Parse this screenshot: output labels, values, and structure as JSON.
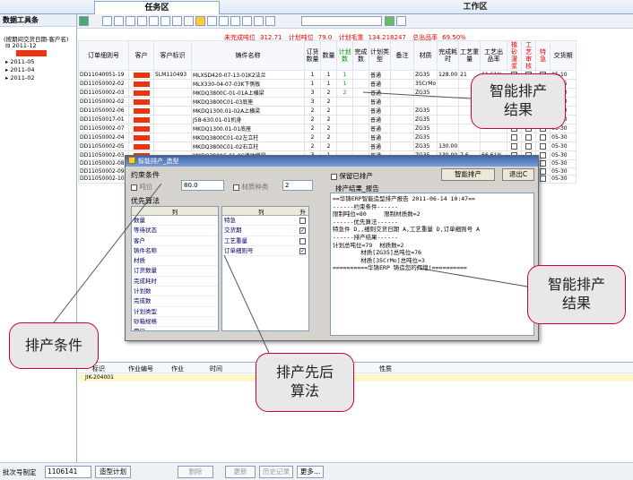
{
  "tabs": [
    "任务区",
    "工作区"
  ],
  "left_panel": {
    "title": "数据工具条",
    "root": "(按期间交货日期-客户名)",
    "nodes": [
      "2011-12",
      "2011-05",
      "2011-04",
      "2011-02"
    ]
  },
  "stats": {
    "uncompleted_label": "未完成吨位",
    "uncompleted_value": "312.71",
    "plan_label": "计划吨位",
    "plan_value": "79.0",
    "plan_weight_label": "计划毛重",
    "plan_weight_value": "134.218247",
    "yield_label": "总出品率",
    "yield_value": "69.50%"
  },
  "grid": {
    "headers": [
      "订单细则号",
      "客户",
      "客户标识",
      "铸件名称",
      "订货数量",
      "数量",
      "计划数",
      "完成数",
      "计划类型",
      "备注",
      "材质",
      "完成耗时",
      "工艺重量",
      "工艺出品率",
      "植砂灌浆",
      "工艺审核",
      "特急",
      "交货期"
    ],
    "rows": [
      {
        "id": "DD11040051-19",
        "tag": "5LM110493",
        "name": "MLXSD420-07-13-01K2法兰",
        "qty": "1",
        "n": "1",
        "plan": "1",
        "done": "",
        "type": "普通",
        "mat": "ZG35",
        "t": "128.00",
        "w": "21",
        "y": "61.61%",
        "due": "05-10"
      },
      {
        "id": "DD11050002-02",
        "tag": "",
        "name": "MLX330-04-07-03K下侧板",
        "qty": "1",
        "n": "1",
        "plan": "1",
        "done": "",
        "type": "普通",
        "mat": "35CrMo",
        "t": "",
        "w": "",
        "y": "",
        "due": "05-15"
      },
      {
        "id": "DD11050002-03",
        "tag": "",
        "name": "MKDQ3800C-01-01A上横梁",
        "qty": "3",
        "n": "2",
        "plan": "2",
        "done": "",
        "type": "普通",
        "mat": "ZG35",
        "t": "",
        "w": "",
        "y": "",
        "due": "05-30"
      },
      {
        "id": "DD11050002-02",
        "tag": "",
        "name": "MKDQ3800C01-03底座",
        "qty": "3",
        "n": "2",
        "plan": "",
        "done": "",
        "type": "普通",
        "mat": "",
        "t": "",
        "w": "",
        "y": "",
        "due": "05-30"
      },
      {
        "id": "DD11050002-06",
        "tag": "",
        "name": "MKDQ1300.01-02A上横梁",
        "qty": "2",
        "n": "2",
        "plan": "",
        "done": "",
        "type": "普通",
        "mat": "ZG35",
        "t": "",
        "w": "",
        "y": "",
        "due": "05-30"
      },
      {
        "id": "DD11050017-01",
        "tag": "",
        "name": "J58-630.01-01机身",
        "qty": "2",
        "n": "2",
        "plan": "",
        "done": "",
        "type": "普通",
        "mat": "ZG35",
        "t": "",
        "w": "",
        "y": "",
        "due": "05-30"
      },
      {
        "id": "DD11050002-07",
        "tag": "",
        "name": "MKDQ1300.01-01底座",
        "qty": "2",
        "n": "2",
        "plan": "",
        "done": "",
        "type": "普通",
        "mat": "ZG35",
        "t": "",
        "w": "",
        "y": "",
        "due": "05-30"
      },
      {
        "id": "DD11050002-04",
        "tag": "",
        "name": "MKDQ3800C01-02左立柱",
        "qty": "2",
        "n": "2",
        "plan": "",
        "done": "",
        "type": "普通",
        "mat": "ZG35",
        "t": "",
        "w": "",
        "y": "",
        "due": "05-30"
      },
      {
        "id": "DD11050002-05",
        "tag": "",
        "name": "MKDQ3800C01-02右立柱",
        "qty": "2",
        "n": "2",
        "plan": "",
        "done": "",
        "type": "普通",
        "mat": "ZG35",
        "t": "130.00",
        "w": "",
        "y": "",
        "due": "05-30"
      },
      {
        "id": "DD11050002-03",
        "tag": "",
        "name": "MKDQ3800C-01-06活动横梁",
        "qty": "3",
        "n": "1",
        "plan": "",
        "done": "",
        "type": "普通",
        "mat": "ZG35",
        "t": "130.00",
        "w": "7.6",
        "y": "66.61%",
        "due": "05-30"
      }
    ],
    "extra_ids": [
      "DD11050002-08",
      "DD11050002-09",
      "DD11050002-10",
      "DD10110072-0"
    ],
    "extra_due": [
      "05-30",
      "05-30",
      "05-30",
      "12-05"
    ]
  },
  "dialog": {
    "title": "智能排产_造型",
    "keep_label": "保留已排产",
    "run_button": "智能排产",
    "exit_button": "退出C",
    "constraints_label": "约束条件",
    "tonnage_label": "吨位",
    "tonnage_value": "80.0",
    "material_label": "材质种类",
    "material_value": "2",
    "priority_label": "优先算法",
    "col_header": "列",
    "left_list": [
      "数量",
      "等待状态",
      "客户",
      "铸件名称",
      "材质",
      "订货数量",
      "完成耗时",
      "计划数",
      "完成数",
      "计划类型",
      "砂箱规格",
      "冒口"
    ],
    "right_header_a": "列",
    "right_header_b": "升",
    "right_list": [
      "特急",
      "交货期",
      "工艺重量",
      "订单细则号"
    ],
    "result_label": "排产结果_报告",
    "report": [
      "==华铸ERP智能造型排产报告 2011-06-14 10:47==",
      "------约束条件------",
      "限制吨位=80     限制材质数=2",
      "------优先算法------",
      "特急件 D,,细则交货日期 A,工艺重量 D,订单细则号 A",
      "------排产结果------",
      "计划总吨位=79  材质数=2",
      "        材质[ZG35]总吨位=76",
      "        材质[35CrMo]总吨位=3",
      "==========华铸ERP 铸造您的辉煌!=========="
    ]
  },
  "callouts": {
    "result_top": "智能排产\n结果",
    "result_right": "智能排产\n结果",
    "conditions": "排产条件",
    "algorithm": "排产先后\n算法"
  },
  "lower_panel": {
    "headers": [
      "标识",
      "作业编号",
      "作业",
      "时间",
      "完整",
      "结",
      "性质"
    ],
    "row_id": "JIK-204001"
  },
  "bottom_bar": {
    "batch_label": "批次号制定",
    "batch_value": "1106141",
    "plan_button": "造型计划",
    "delete_button": "删除",
    "update_button": "更新",
    "history_button": "历史记录",
    "more_button": "更多..."
  }
}
